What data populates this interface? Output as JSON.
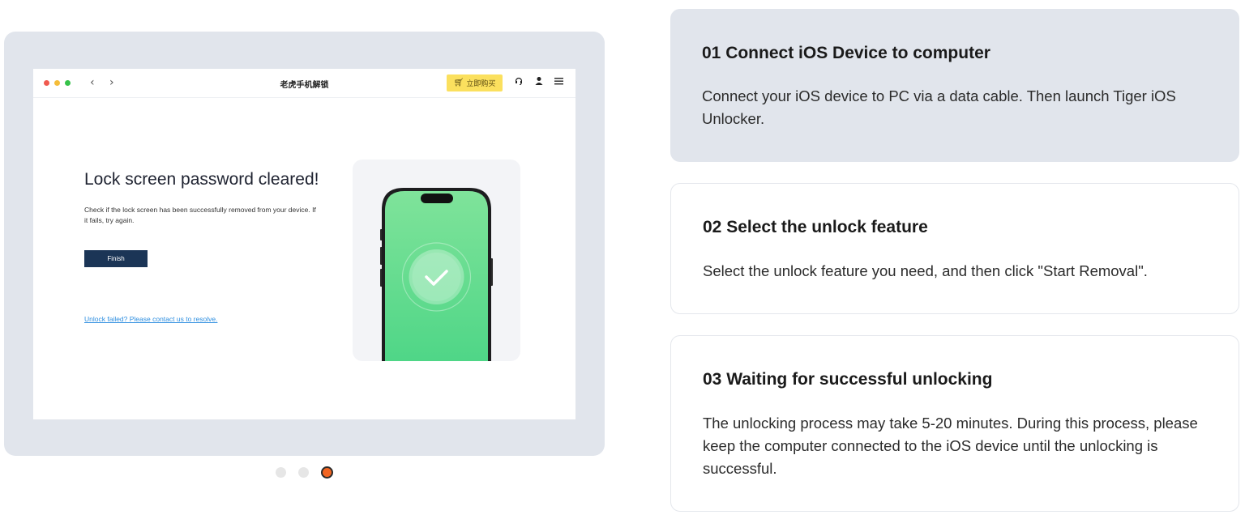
{
  "app_window": {
    "title": "老虎手机解锁",
    "buy_label": "立即购买",
    "icons": {
      "back": "chevron-left-icon",
      "forward": "chevron-right-icon",
      "cart": "cart-icon",
      "support": "headset-icon",
      "user": "user-icon",
      "menu": "menu-icon"
    },
    "result_title": "Lock screen password cleared!",
    "result_desc": "Check if the lock screen has been successfully removed from your device. If it fails, try again.",
    "finish_label": "Finish",
    "help_link": "Unlock failed? Please contact us to resolve."
  },
  "carousel": {
    "total": 3,
    "active_index": 3
  },
  "colors": {
    "accent": "#f26522",
    "finish_button": "#1b3556",
    "buy_button": "#fbe05e",
    "link": "#2f8fe0",
    "phone_screen": "#66dc8e"
  },
  "steps": [
    {
      "title": "01 Connect iOS Device to computer",
      "text": "Connect your iOS device to PC via a data cable. Then launch Tiger iOS Unlocker.",
      "active": true
    },
    {
      "title": "02 Select the unlock feature",
      "text": "Select the unlock feature you need, and then click \"Start Removal\".",
      "active": false
    },
    {
      "title": "03 Waiting for successful unlocking",
      "text": "The unlocking process may take 5-20 minutes. During this process, please keep the computer connected to the iOS device until the unlocking is successful.",
      "active": false
    }
  ]
}
